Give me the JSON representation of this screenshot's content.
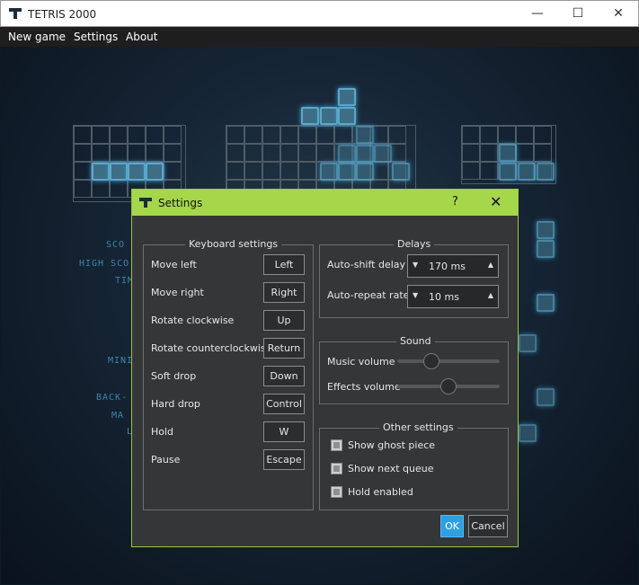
{
  "window": {
    "title": "TETRIS 2000",
    "minimize": "—",
    "maximize": "☐",
    "close": "✕"
  },
  "menu": {
    "items": [
      "New game",
      "Settings",
      "About"
    ]
  },
  "hud": {
    "labels": [
      "SCO",
      "HIGH SCO",
      "TIM",
      "MINI",
      "BACK-",
      "MA",
      "L"
    ]
  },
  "dialog": {
    "title": "Settings",
    "help": "?",
    "close": "✕",
    "keyboard": {
      "title": "Keyboard settings",
      "rows": [
        {
          "label": "Move left",
          "key": "Left"
        },
        {
          "label": "Move right",
          "key": "Right"
        },
        {
          "label": "Rotate clockwise",
          "key": "Up"
        },
        {
          "label": "Rotate counterclockwise",
          "key": "Return"
        },
        {
          "label": "Soft drop",
          "key": "Down"
        },
        {
          "label": "Hard drop",
          "key": "Control"
        },
        {
          "label": "Hold",
          "key": "W"
        },
        {
          "label": "Pause",
          "key": "Escape"
        }
      ]
    },
    "delays": {
      "title": "Delays",
      "auto_shift_label": "Auto-shift delay",
      "auto_shift_value": "170 ms",
      "auto_repeat_label": "Auto-repeat rate",
      "auto_repeat_value": "10 ms"
    },
    "sound": {
      "title": "Sound",
      "music_label": "Music volume",
      "music_level": 0.3,
      "effects_label": "Effects volume",
      "effects_level": 0.5
    },
    "other": {
      "title": "Other settings",
      "ghost_label": "Show ghost piece",
      "next_label": "Show next queue",
      "hold_label": "Hold enabled"
    },
    "ok_label": "OK",
    "cancel_label": "Cancel"
  },
  "colors": {
    "dialog_title_bar": "#a6d64a",
    "ok_button": "#2e9fe0",
    "block_glow": "#5fa7c8"
  }
}
